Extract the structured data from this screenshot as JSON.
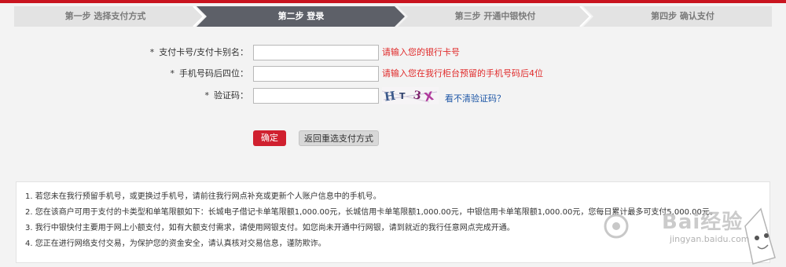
{
  "steps": [
    {
      "label": "第一步  选择支付方式",
      "state": "done"
    },
    {
      "label": "第二步  登录",
      "state": "active"
    },
    {
      "label": "第三步  开通中银快付",
      "state": "todo"
    },
    {
      "label": "第四步  确认支付",
      "state": "todo"
    }
  ],
  "form": {
    "required_mark": "*",
    "card_label": "支付卡号/支付卡别名：",
    "card_value": "",
    "card_hint": "请输入您的银行卡号",
    "phone_label": "手机号码后四位：",
    "phone_value": "",
    "phone_hint": "请输入您在我行柜台预留的手机号码后4位",
    "captcha_label": "验证码：",
    "captcha_value": "",
    "captcha_image_text": "H T 3 X",
    "captcha_refresh": "看不清验证码？"
  },
  "buttons": {
    "confirm": "确定",
    "back": "返回重选支付方式"
  },
  "notes": [
    "1. 若您未在我行预留手机号，或更换过手机号，请前往我行网点补充或更新个人账户信息中的手机号。",
    "2. 您在该商户可用于支付的卡类型和单笔限额如下：长城电子借记卡单笔限额1,000.00元，长城信用卡单笔限额1,000.00元，中银信用卡单笔限额1,000.00元，您每日累计最多可支付5,000.00元。",
    "3. 我行中银快付主要用于网上小额支付，如有大额支付需求，请使用网银支付。如您尚未开通中行网银，请到就近的我行任意网点完成开通。",
    "4. 您正在进行网络支付交易，为保护您的资金安全，请认真核对交易信息，谨防欺诈。"
  ],
  "watermark": {
    "brand": "Bai经验",
    "url": "jingyan.baidu.com"
  },
  "colors": {
    "accent_red": "#d0202f",
    "step_active": "#5d6068",
    "step_inactive": "#e3e3e3",
    "hint_red": "#e02a2a",
    "link_blue": "#1d56a6"
  }
}
